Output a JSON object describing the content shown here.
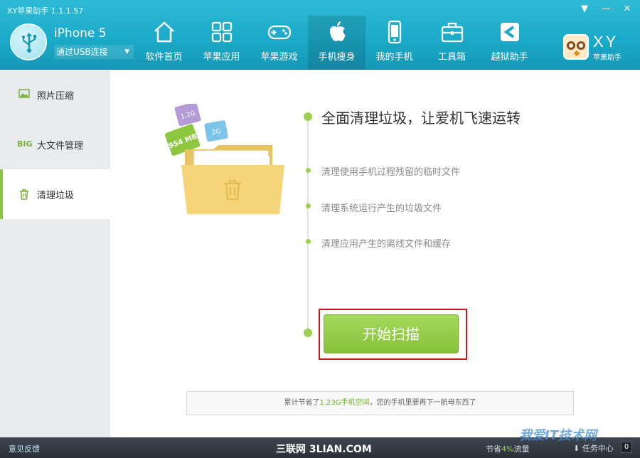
{
  "window": {
    "title": "XY苹果助手 1.1.1.57",
    "menu_icon": "dropdown-triangle-icon",
    "minimize_icon": "minimize-icon",
    "close_icon": "close-icon"
  },
  "device": {
    "name": "iPhone 5",
    "connection": "通过USB连接",
    "icon": "usb-icon"
  },
  "nav": [
    {
      "label": "软件首页",
      "icon": "home-icon"
    },
    {
      "label": "苹果应用",
      "icon": "apps-grid-icon"
    },
    {
      "label": "苹果游戏",
      "icon": "gamepad-icon"
    },
    {
      "label": "手机瘦身",
      "icon": "apple-slim-icon",
      "active": true
    },
    {
      "label": "我的手机",
      "icon": "phone-icon"
    },
    {
      "label": "工具箱",
      "icon": "toolbox-icon"
    },
    {
      "label": "越狱助手",
      "icon": "jailbreak-icon"
    }
  ],
  "brand": {
    "logo": "XY",
    "subtitle": "苹果助手"
  },
  "sidebar": [
    {
      "label": "照片压缩",
      "icon": "photo-icon"
    },
    {
      "label": "大文件管理",
      "icon_text": "BIG"
    },
    {
      "label": "清理垃圾",
      "icon": "trash-icon",
      "active": true
    }
  ],
  "illustration": {
    "file_badges": [
      "954 MB",
      "1.2G",
      "2G"
    ]
  },
  "main": {
    "headline": "全面清理垃圾，让爱机飞速运转",
    "features": [
      "清理使用手机过程残留的临时文件",
      "清理系统运行产生的垃圾文件",
      "清理应用产生的离线文件和缓存"
    ],
    "scan_button": "开始扫描",
    "stats_prefix": "累计节省了",
    "stats_amount": "1.23G手机空间",
    "stats_suffix": "，您的手机里要再下一航母东西了"
  },
  "footer": {
    "feedback": "意见反馈",
    "watermark": "三联网 3LIAN.COM",
    "saved_prefix": "节省",
    "saved_pct": "4%",
    "saved_suffix": "流量",
    "task_center": "任务中心",
    "task_count": "0"
  },
  "watermark2": "我爱IT技术网",
  "colors": {
    "header": "#1aa9c8",
    "accent_green": "#8dc63f",
    "highlight_red": "#c8191f"
  }
}
